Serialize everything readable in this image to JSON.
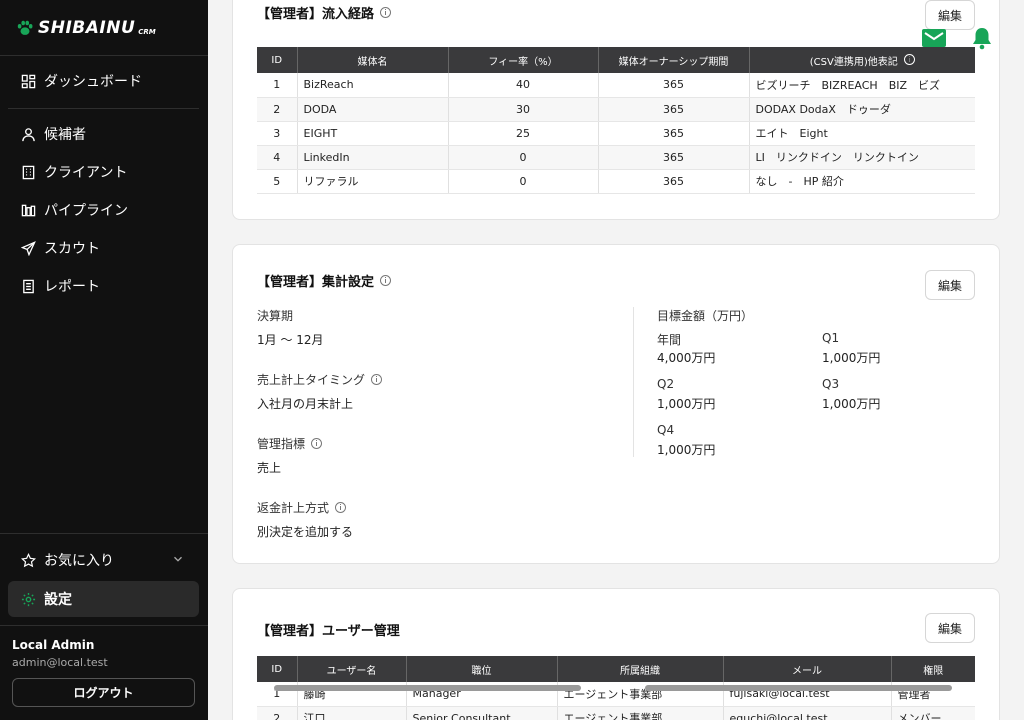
{
  "app": {
    "brand": "SHIBAINU",
    "brand_sub": "CRM"
  },
  "sidebar": {
    "dashboard": "ダッシュボード",
    "items": [
      {
        "label": "候補者"
      },
      {
        "label": "クライアント"
      },
      {
        "label": "パイプライン"
      },
      {
        "label": "スカウト"
      },
      {
        "label": "レポート"
      }
    ],
    "favorites": "お気に入り",
    "settings": "設定",
    "user_name": "Local Admin",
    "user_email": "admin@local.test",
    "logout": "ログアウト"
  },
  "sources": {
    "title": "【管理者】流入経路",
    "edit": "編集",
    "headers": [
      "ID",
      "媒体名",
      "フィー率（%）",
      "媒体オーナーシップ期間",
      "(CSV連携用)他表記"
    ],
    "rows": [
      {
        "id": "1",
        "name": "BizReach",
        "fee": "40",
        "period": "365",
        "alias": "ビズリーチ　BIZREACH　BIZ　ビズ"
      },
      {
        "id": "2",
        "name": "DODA",
        "fee": "30",
        "period": "365",
        "alias": "DODAX DodaX　ドゥーダ"
      },
      {
        "id": "3",
        "name": "EIGHT",
        "fee": "25",
        "period": "365",
        "alias": "エイト　Eight"
      },
      {
        "id": "4",
        "name": "LinkedIn",
        "fee": "0",
        "period": "365",
        "alias": "LI　リンクドイン　リンクトイン"
      },
      {
        "id": "5",
        "name": "リファラル",
        "fee": "0",
        "period": "365",
        "alias": "なし　-　HP 紹介"
      }
    ]
  },
  "agg": {
    "title": "【管理者】集計設定",
    "edit": "編集",
    "fiscal_label": "決算期",
    "fiscal_value": "1月 〜 12月",
    "timing_label": "売上計上タイミング",
    "timing_value": "入社月の月末計上",
    "metric_label": "管理指標",
    "metric_value": "売上",
    "refund_label": "返金計上方式",
    "refund_value": "別決定を追加する",
    "target_label": "目標金額（万円）",
    "targets": [
      {
        "label": "年間",
        "value": "4,000万円"
      },
      {
        "label": "Q1",
        "value": "1,000万円"
      },
      {
        "label": "Q2",
        "value": "1,000万円"
      },
      {
        "label": "Q3",
        "value": "1,000万円"
      },
      {
        "label": "Q4",
        "value": "1,000万円"
      }
    ]
  },
  "users": {
    "title": "【管理者】ユーザー管理",
    "edit": "編集",
    "headers": [
      "ID",
      "ユーザー名",
      "職位",
      "所属組織",
      "メール",
      "権限"
    ],
    "rows": [
      {
        "id": "1",
        "name": "藤崎",
        "position": "Manager",
        "org": "エージェント事業部",
        "email": "fujisaki@local.test",
        "role": "管理者"
      },
      {
        "id": "2",
        "name": "江口",
        "position": "Senior Consultant",
        "org": "エージェント事業部",
        "email": "eguchi@local.test",
        "role": "メンバー"
      }
    ]
  },
  "colors": {
    "accent": "#18a558",
    "sidebar_bg": "#111111",
    "header_bg": "#3a3a3c"
  }
}
